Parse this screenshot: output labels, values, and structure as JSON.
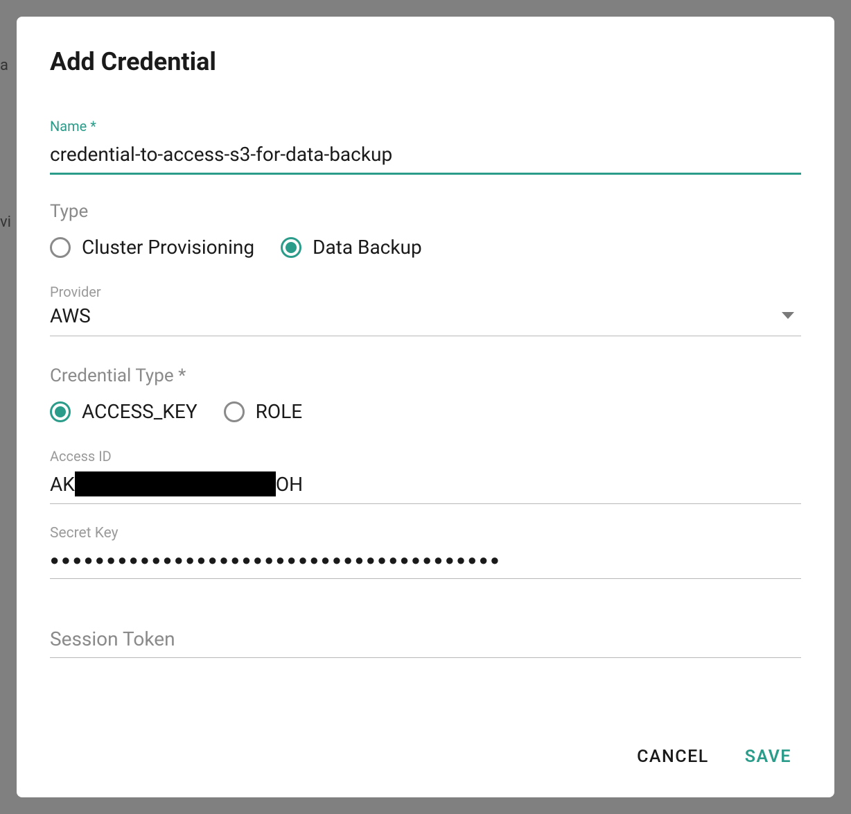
{
  "dialog": {
    "title": "Add Credential"
  },
  "name_field": {
    "label": "Name",
    "value": "credential-to-access-s3-for-data-backup"
  },
  "type_group": {
    "label": "Type",
    "options": [
      {
        "label": "Cluster Provisioning",
        "checked": false
      },
      {
        "label": "Data Backup",
        "checked": true
      }
    ]
  },
  "provider_field": {
    "label": "Provider",
    "value": "AWS"
  },
  "credential_type_group": {
    "label": "Credential Type",
    "options": [
      {
        "label": "ACCESS_KEY",
        "checked": true
      },
      {
        "label": "ROLE",
        "checked": false
      }
    ]
  },
  "access_id_field": {
    "label": "Access ID",
    "prefix": "AK",
    "suffix": "OH"
  },
  "secret_key_field": {
    "label": "Secret Key",
    "masked_value": "●●●●●●●●●●●●●●●●●●●●●●●●●●●●●●●●●●●●●●●●"
  },
  "session_token_field": {
    "placeholder": "Session Token",
    "value": ""
  },
  "actions": {
    "cancel": "CANCEL",
    "save": "SAVE"
  },
  "colors": {
    "accent": "#2b9c8a"
  }
}
